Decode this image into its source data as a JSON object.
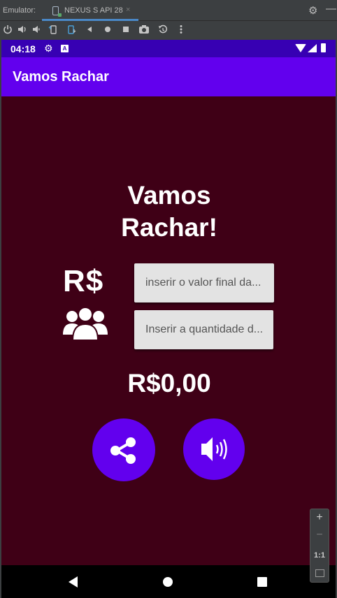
{
  "ide": {
    "window_label": "Emulator:",
    "tab_title": "NEXUS S API 28",
    "tab_close": "×",
    "toolbar_icons": [
      "power-icon",
      "volume-up-icon",
      "volume-down-icon",
      "rotate-left-icon",
      "rotate-right-icon",
      "back-icon",
      "home-icon",
      "overview-icon",
      "screenshot-icon",
      "snapshot-icon",
      "more-icon"
    ],
    "zoom": {
      "in": "+",
      "out": "−",
      "ratio": "1:1"
    }
  },
  "device": {
    "status_bar": {
      "time": "04:18"
    },
    "app_bar": {
      "title": "Vamos Rachar"
    },
    "main": {
      "headline": "Vamos Rachar!",
      "currency_label": "R$",
      "value_field": {
        "placeholder": "inserir o valor final da...",
        "value": ""
      },
      "people_field": {
        "placeholder": "Inserir a quantidade d...",
        "value": ""
      },
      "total": "R$0,00"
    },
    "colors": {
      "primary": "#6200ee",
      "primary_dark": "#3700b3",
      "background": "#3f0016"
    }
  }
}
